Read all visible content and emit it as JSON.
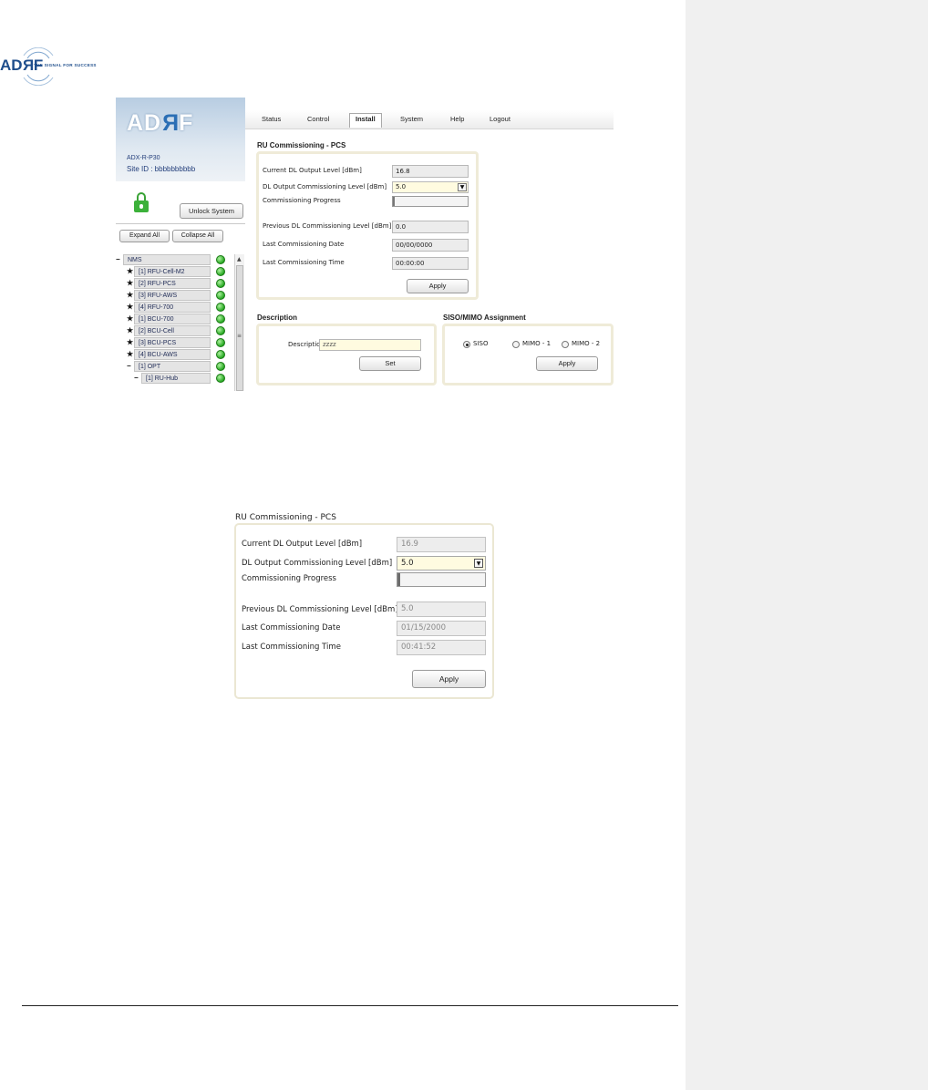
{
  "brand": {
    "logo_text": "ADRF",
    "tagline": "THE SIGNAL FOR SUCCESS"
  },
  "shot1": {
    "sidebar": {
      "logo_text": "ADRF",
      "model": "ADX-R-P30",
      "site_id": "Site ID : bbbbbbbbbb",
      "unlock_button": "Unlock System",
      "expand_all": "Expand All",
      "collapse_all": "Collapse All",
      "tree": [
        {
          "marker": "−",
          "label": "NMS",
          "status": "green"
        },
        {
          "marker": "★",
          "label": "[1] RFU-Cell-M2",
          "status": "green"
        },
        {
          "marker": "★",
          "label": "[2] RFU-PCS",
          "status": "green"
        },
        {
          "marker": "★",
          "label": "[3] RFU-AWS",
          "status": "green"
        },
        {
          "marker": "★",
          "label": "[4] RFU-700",
          "status": "green"
        },
        {
          "marker": "★",
          "label": "[1] BCU-700",
          "status": "green"
        },
        {
          "marker": "★",
          "label": "[2] BCU-Cell",
          "status": "green"
        },
        {
          "marker": "★",
          "label": "[3] BCU-PCS",
          "status": "green"
        },
        {
          "marker": "★",
          "label": "[4] BCU-AWS",
          "status": "green"
        },
        {
          "marker": "−",
          "label": "[1] OPT",
          "status": "green"
        },
        {
          "marker": "−",
          "label": "[1] RU-Hub",
          "status": "green"
        }
      ]
    },
    "tabs": [
      "Status",
      "Control",
      "Install",
      "System",
      "Help",
      "Logout"
    ],
    "active_tab": "Install",
    "commissioning": {
      "title": "RU Commissioning - PCS",
      "current_dl_label": "Current DL Output Level [dBm]",
      "current_dl_value": "16.8",
      "dl_comm_label": "DL Output Commissioning Level [dBm]",
      "dl_comm_value": "5.0",
      "progress_label": "Commissioning Progress",
      "progress": 0,
      "prev_dl_label": "Previous DL Commissioning Level [dBm]",
      "prev_dl_value": "0.0",
      "date_label": "Last Commissioning Date",
      "date_value": "00/00/0000",
      "time_label": "Last Commissioning Time",
      "time_value": "00:00:00",
      "apply": "Apply"
    },
    "description": {
      "title": "Description",
      "label": "Description",
      "value": "zzzz",
      "set": "Set"
    },
    "siso": {
      "title": "SISO/MIMO Assignment",
      "options": [
        "SISO",
        "MIMO - 1",
        "MIMO - 2"
      ],
      "selected": "SISO",
      "apply": "Apply"
    }
  },
  "shot2": {
    "title": "RU Commissioning - PCS",
    "current_dl_label": "Current DL Output Level [dBm]",
    "current_dl_value": "16.9",
    "dl_comm_label": "DL Output Commissioning Level [dBm]",
    "dl_comm_value": "5.0",
    "progress_label": "Commissioning Progress",
    "progress": 0,
    "prev_dl_label": "Previous DL Commissioning Level [dBm]",
    "prev_dl_value": "5.0",
    "date_label": "Last Commissioning Date",
    "date_value": "01/15/2000",
    "time_label": "Last Commissioning Time",
    "time_value": "00:41:52",
    "apply": "Apply"
  },
  "colors": {
    "brand_blue": "#1f4e8c",
    "status_green": "#27a822",
    "panel_border": "#efebd8",
    "input_highlight": "#fffbe0"
  }
}
